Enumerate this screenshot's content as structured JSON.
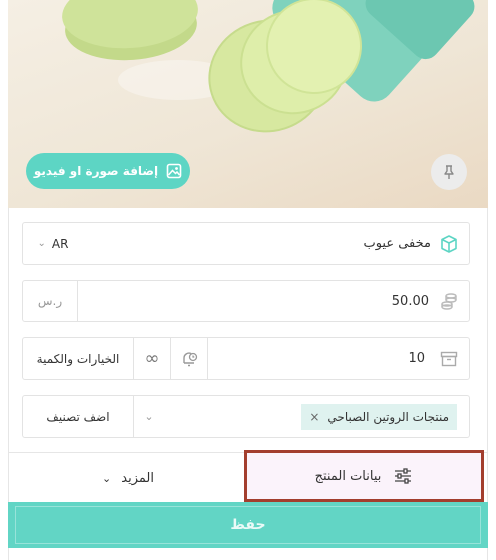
{
  "media": {
    "add_button_label": "إضافة صورة او فيديو",
    "add_icon": "image-icon",
    "pin_icon": "pin-icon"
  },
  "product": {
    "name": "مخفى عيوب",
    "name_icon": "box-icon",
    "language": "AR"
  },
  "price": {
    "value": "50.00",
    "currency": "ر.س",
    "icon": "coins-icon"
  },
  "quantity": {
    "value": "10",
    "icon": "inventory-box-icon",
    "unlimited_icon": "infinity-icon",
    "notify_icon": "bell-clock-icon",
    "options_label": "الخيارات والكمية"
  },
  "category": {
    "chip_label": "منتجات الروتين الصباحي",
    "chip_remove": "×",
    "add_label": "اضف تصنيف"
  },
  "tabs": {
    "product_data": "بيانات المنتج",
    "more": "المزيد"
  },
  "save_label": "حفظ",
  "colors": {
    "accent": "#5dd5c4",
    "highlight_border": "#a33e2e",
    "chip_bg": "#dff2ef"
  }
}
